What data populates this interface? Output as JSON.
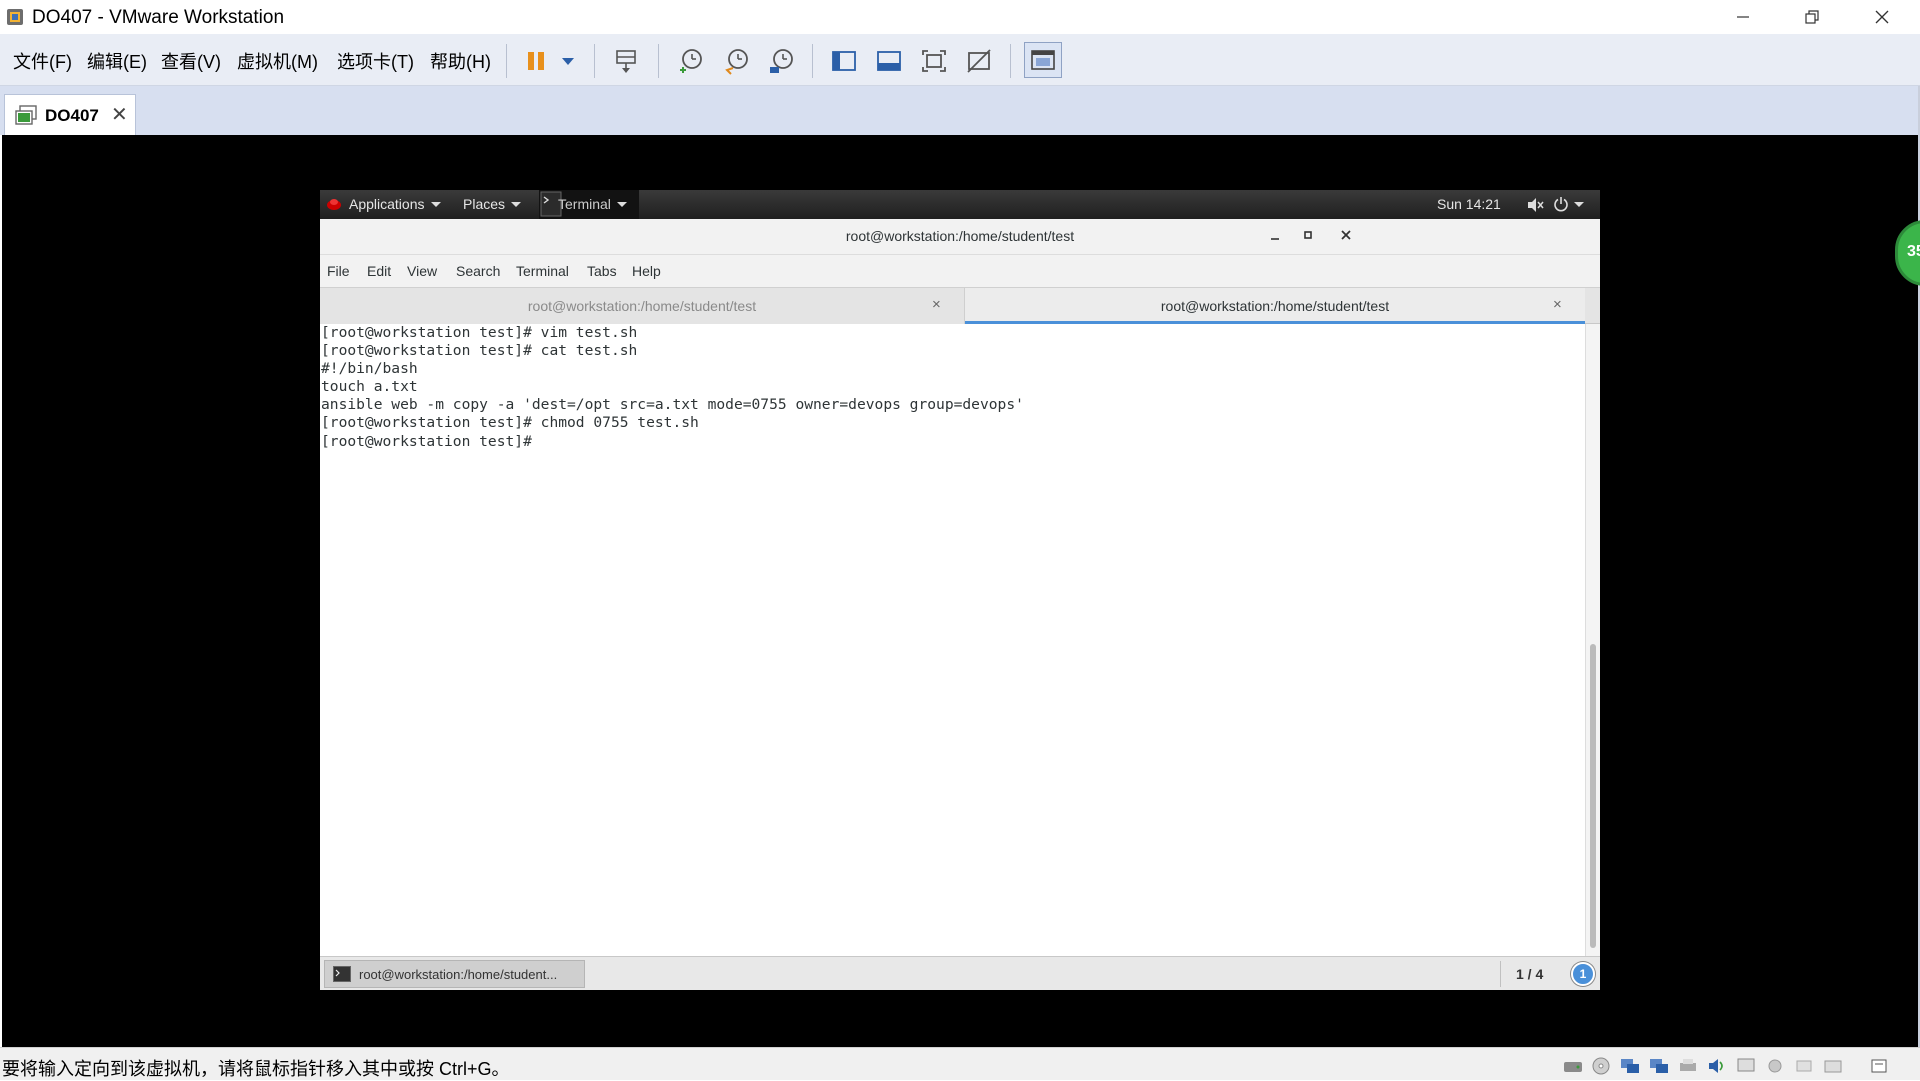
{
  "window": {
    "title": "DO407 - VMware Workstation",
    "min_glyph": "—",
    "restore_glyph": "❐",
    "close_glyph": "✕"
  },
  "menu": [
    "文件(F)",
    "编辑(E)",
    "查看(V)",
    "虚拟机(M)",
    "选项卡(T)",
    "帮助(H)"
  ],
  "vm_tab": {
    "label": "DO407",
    "close": "✕"
  },
  "gnome": {
    "applications": "Applications",
    "places": "Places",
    "terminal": "Terminal",
    "clock": "Sun 14:21"
  },
  "terminal": {
    "title": "root@workstation:/home/student/test",
    "menu": [
      "File",
      "Edit",
      "View",
      "Search",
      "Terminal",
      "Tabs",
      "Help"
    ],
    "tabs": [
      {
        "label": "root@workstation:/home/student/test",
        "active": false
      },
      {
        "label": "root@workstation:/home/student/test",
        "active": true
      }
    ],
    "lines": [
      "[root@workstation test]# vim test.sh",
      "[root@workstation test]# cat test.sh",
      "#!/bin/bash",
      "touch a.txt",
      "ansible web -m copy -a 'dest=/opt src=a.txt mode=0755 owner=devops group=devops'",
      "[root@workstation test]# chmod 0755 test.sh",
      "[root@workstation test]# "
    ],
    "tab_close": "×"
  },
  "window_list": {
    "item": "root@workstation:/home/student...",
    "workspace": "1 / 4",
    "notify_count": "1"
  },
  "overlay_badge": "35",
  "status": {
    "text": "要将输入定向到该虚拟机，请将鼠标指针移入其中或按 Ctrl+G。"
  },
  "colors": {
    "accent_active_tab": "#4a90d9",
    "pause_orange": "#e8901c",
    "vm_background": "#000000"
  }
}
